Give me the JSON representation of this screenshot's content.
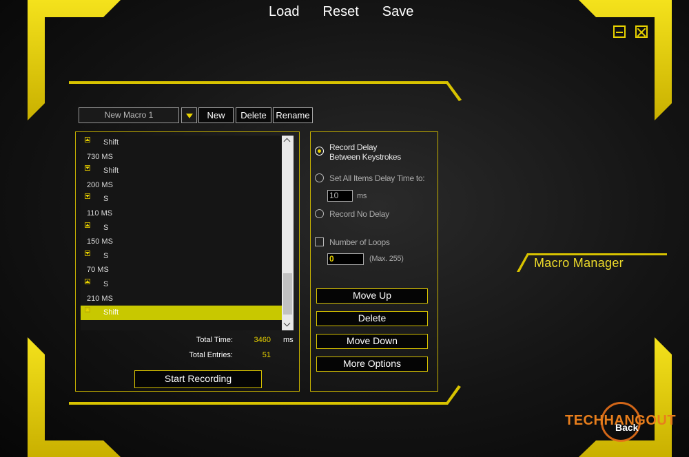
{
  "top_menu": {
    "load": "Load",
    "reset": "Reset",
    "save": "Save"
  },
  "macro": {
    "selected_name": "New Macro 1",
    "new_label": "New",
    "delete_label": "Delete",
    "rename_label": "Rename"
  },
  "list": {
    "rows": [
      {
        "type": "key",
        "dir": "up",
        "text": "Shift"
      },
      {
        "type": "delay",
        "text": "730 MS"
      },
      {
        "type": "key",
        "dir": "down",
        "text": "Shift"
      },
      {
        "type": "delay",
        "text": "200 MS"
      },
      {
        "type": "key",
        "dir": "down",
        "text": "S"
      },
      {
        "type": "delay",
        "text": "110 MS"
      },
      {
        "type": "key",
        "dir": "up",
        "text": "S"
      },
      {
        "type": "delay",
        "text": "150 MS"
      },
      {
        "type": "key",
        "dir": "down",
        "text": "S"
      },
      {
        "type": "delay",
        "text": "70 MS"
      },
      {
        "type": "key",
        "dir": "up",
        "text": "S"
      },
      {
        "type": "delay",
        "text": "210 MS"
      },
      {
        "type": "key",
        "dir": "up",
        "text": "Shift",
        "selected": true
      }
    ]
  },
  "stats": {
    "total_time_label": "Total Time:",
    "total_time_value": "3460",
    "total_time_unit": "ms",
    "total_entries_label": "Total Entries:",
    "total_entries_value": "51"
  },
  "start_recording_label": "Start Recording",
  "options": {
    "record_delay_line1": "Record Delay",
    "record_delay_line2": "Between Keystrokes",
    "set_all_label": "Set All Items Delay Time to:",
    "delay_value": "10",
    "delay_unit": "ms",
    "no_delay_label": "Record No Delay",
    "loops_label": "Number of Loops",
    "loops_value": "0",
    "loops_max": "(Max. 255)"
  },
  "actions": {
    "move_up": "Move Up",
    "delete": "Delete",
    "move_down": "Move Down",
    "more_options": "More Options"
  },
  "page_title": "Macro Manager",
  "logo": {
    "part1": "TECH",
    "part2": "HANGOUT"
  },
  "back_label": "Back",
  "colors": {
    "accent": "#e8d200",
    "selected_row": "#c8c800",
    "logo": "#e87e1c"
  }
}
